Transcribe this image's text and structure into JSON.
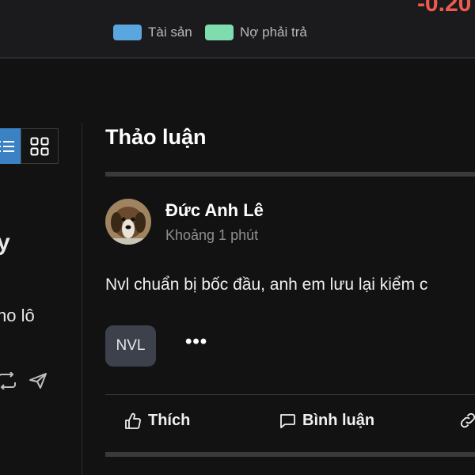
{
  "header": {
    "price_change": "-0.20 /",
    "legend": [
      {
        "label": "Tài sản",
        "color": "#5aa7e0"
      },
      {
        "label": "Nợ phải trả",
        "color": "#7fdcae"
      }
    ]
  },
  "left_panel": {
    "partial_heading": "y",
    "partial_text": "no lô",
    "view_modes": [
      "list-icon",
      "grid-icon"
    ]
  },
  "discussion": {
    "title": "Thảo luận",
    "post": {
      "author": "Đức Anh Lê",
      "time": "Khoảng 1 phút",
      "content": "Nvl chuẩn bị bốc đầu, anh em lưu lại kiểm c",
      "tag": "NVL",
      "more_label": "•••",
      "actions": {
        "like": "Thích",
        "comment": "Bình luận"
      }
    }
  },
  "colors": {
    "accent": "#3b82c4",
    "negative": "#f05a4d",
    "background": "#121212"
  }
}
